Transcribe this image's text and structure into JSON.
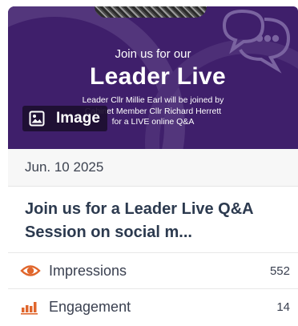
{
  "hero": {
    "kicker": "Join us for our",
    "title": "Leader Live",
    "subtitle_lines": [
      "Leader Cllr Millie Earl will be joined by",
      "Cabinet Member Cllr Richard Herrett",
      "for a LIVE online Q&A"
    ],
    "badge_label": "Image",
    "badge_icon": "image-icon",
    "background_color": "#3f1f6b"
  },
  "post": {
    "date": "Jun. 10 2025",
    "headline": "Join us for a Leader Live Q&A Session on social m..."
  },
  "metrics": [
    {
      "label": "Impressions",
      "value": "552",
      "icon": "eye-icon",
      "icon_color": "#e0662c"
    },
    {
      "label": "Engagement",
      "value": "14",
      "icon": "bar-chart-icon",
      "icon_color": "#e0662c"
    }
  ]
}
